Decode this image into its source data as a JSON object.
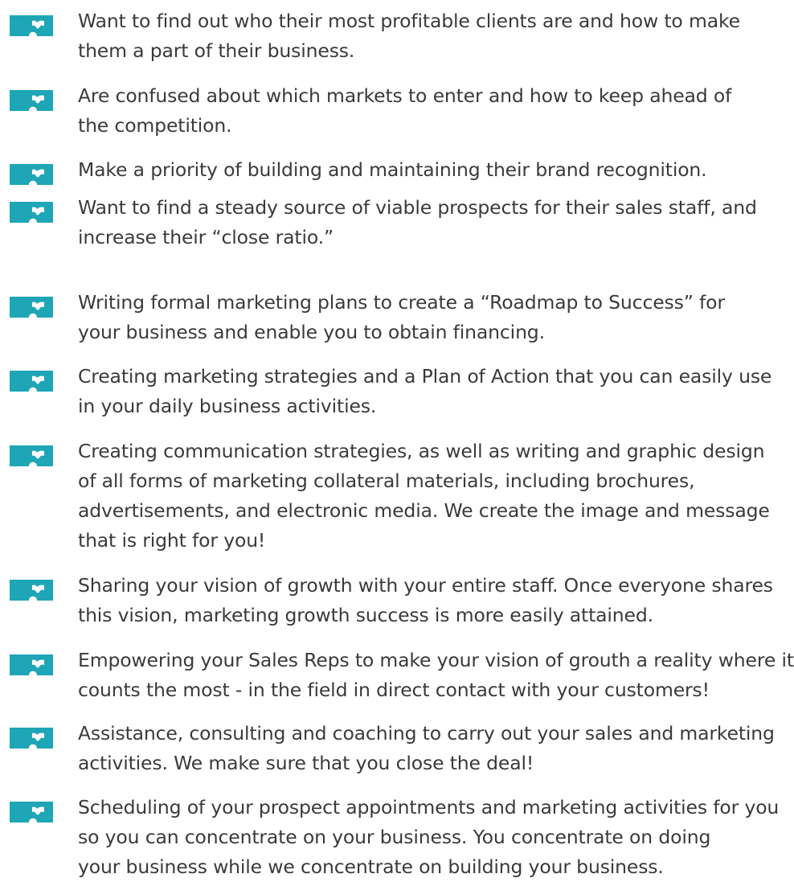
{
  "style": {
    "icon_color": "#1fa6b6",
    "text_color": "#3a3a3a",
    "background": "#ffffff",
    "icon": "puzzle-piece-icon"
  },
  "items": [
    {
      "lines": [
        "Want to find out who their most profitable clients are and how to make",
        "them a part of their business."
      ]
    },
    {
      "lines": [
        "Are confused about which markets to enter and how to keep ahead of",
        "the competition."
      ]
    },
    {
      "lines": [
        "Make a priority of building and maintaining their brand recognition."
      ]
    },
    {
      "lines": [
        "Want to find a steady source of viable prospects for their sales staff, and",
        "increase their “close ratio.”"
      ]
    },
    {
      "lines": [
        "Writing formal marketing plans to create a “Roadmap to Success” for",
        "your business and enable you to obtain financing."
      ]
    },
    {
      "lines": [
        "Creating marketing strategies and a Plan of Action that you can easily use",
        "in your daily business activities."
      ]
    },
    {
      "lines": [
        "Creating communication strategies, as well as writing and graphic design",
        "of all forms of marketing collateral materials, including brochures,",
        "advertisements, and electronic media. We create the image and message",
        "that is right for you!"
      ]
    },
    {
      "lines": [
        "Sharing your vision of growth with your entire staff. Once everyone shares",
        "this vision, marketing growth success is more easily attained."
      ]
    },
    {
      "lines": [
        "Empowering your Sales Reps to make your vision of grouth a reality where it",
        "counts the most - in the field in direct contact with your customers!"
      ]
    },
    {
      "lines": [
        "Assistance, consulting and coaching to carry out your sales and marketing",
        "activities. We make sure that you close the deal!"
      ]
    },
    {
      "lines": [
        "Scheduling of your prospect appointments and marketing activities for you",
        "so you can concentrate on your business. You concentrate on doing",
        "your business while we concentrate on building your business."
      ]
    }
  ]
}
